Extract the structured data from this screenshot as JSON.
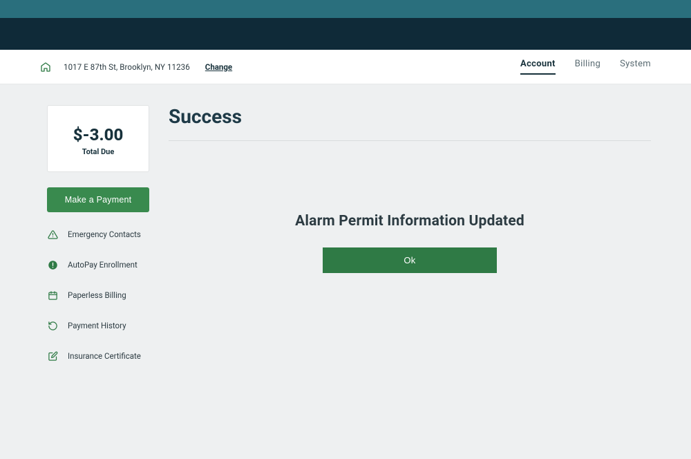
{
  "header": {
    "address": "1017 E 87th St, Brooklyn, NY 11236",
    "change_label": "Change",
    "tabs": [
      {
        "label": "Account",
        "active": true
      },
      {
        "label": "Billing",
        "active": false
      },
      {
        "label": "System",
        "active": false
      }
    ]
  },
  "sidebar": {
    "balance_amount": "$-3.00",
    "balance_label": "Total Due",
    "make_payment_label": "Make a Payment",
    "links": [
      {
        "icon": "alert-triangle-icon",
        "label": "Emergency Contacts"
      },
      {
        "icon": "alert-circle-filled-icon",
        "label": "AutoPay Enrollment"
      },
      {
        "icon": "calendar-icon",
        "label": "Paperless Billing"
      },
      {
        "icon": "history-icon",
        "label": "Payment History"
      },
      {
        "icon": "edit-square-icon",
        "label": "Insurance Certificate"
      }
    ]
  },
  "main": {
    "title": "Success",
    "confirmation_heading": "Alarm Permit Information Updated",
    "ok_label": "Ok"
  },
  "colors": {
    "teal_banner": "#2a6f7d",
    "dark_banner": "#0f2a38",
    "brand_green": "#2f7a45",
    "button_green": "#398a4e",
    "page_bg": "#eef0f1"
  }
}
